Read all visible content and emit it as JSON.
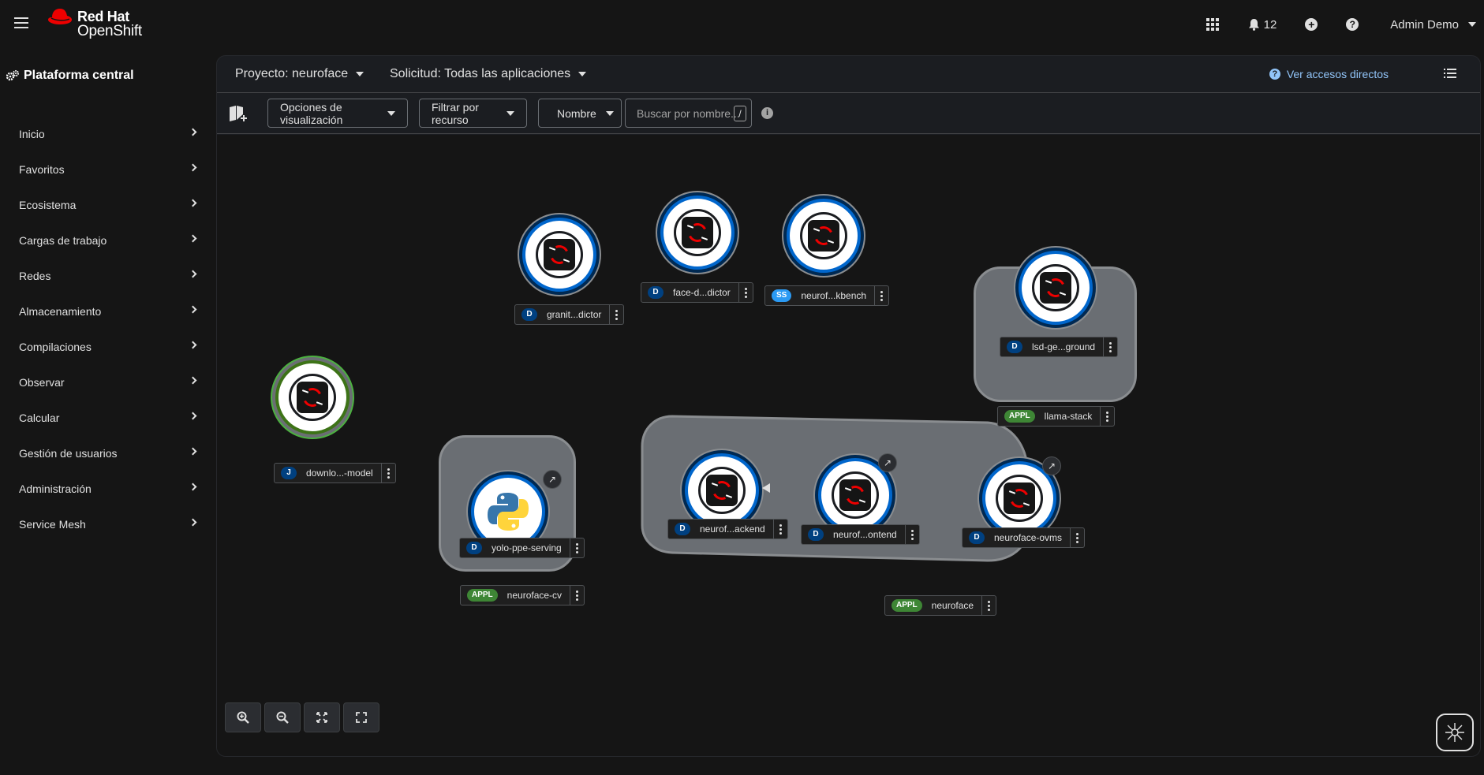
{
  "brand": {
    "line1": "Red Hat",
    "line2": "OpenShift"
  },
  "masthead": {
    "notifications_count": "12",
    "user": "Admin Demo"
  },
  "sidebar": {
    "perspective": "Plataforma central",
    "items": [
      {
        "label": "Inicio"
      },
      {
        "label": "Favoritos"
      },
      {
        "label": "Ecosistema"
      },
      {
        "label": "Cargas de trabajo"
      },
      {
        "label": "Redes"
      },
      {
        "label": "Almacenamiento"
      },
      {
        "label": "Compilaciones"
      },
      {
        "label": "Observar"
      },
      {
        "label": "Calcular"
      },
      {
        "label": "Gestión de usuarios"
      },
      {
        "label": "Administración"
      },
      {
        "label": "Service Mesh"
      }
    ]
  },
  "projectbar": {
    "project": "Proyecto: neuroface",
    "application": "Solicitud: Todas las aplicaciones",
    "shortcuts": "Ver accesos directos"
  },
  "toolbar": {
    "display_options": "Opciones de visualización",
    "filter_resource": "Filtrar por recurso",
    "filter_name": "Nombre",
    "search_placeholder": "Buscar por nombre...",
    "search_key": "/"
  },
  "topology": {
    "nodes": [
      {
        "badge": "D",
        "label": "granit...dictor"
      },
      {
        "badge": "D",
        "label": "face-d...dictor"
      },
      {
        "badge": "SS",
        "label": "neurof...kbench"
      },
      {
        "badge": "D",
        "label": "lsd-ge...ground"
      },
      {
        "badge": "J",
        "label": "downlo...-model"
      },
      {
        "badge": "D",
        "label": "yolo-ppe-serving"
      },
      {
        "badge": "D",
        "label": "neurof...ackend"
      },
      {
        "badge": "D",
        "label": "neurof...ontend"
      },
      {
        "badge": "D",
        "label": "neuroface-ovms"
      }
    ],
    "groups": [
      {
        "badge": "APPL",
        "label": "llama-stack"
      },
      {
        "badge": "APPL",
        "label": "neuroface-cv"
      },
      {
        "badge": "APPL",
        "label": "neuroface"
      }
    ]
  },
  "icons": {
    "zoom_in": "zoom-in-icon",
    "zoom_out": "zoom-out-icon",
    "fit": "fit-to-screen-icon",
    "reset": "reset-view-icon"
  }
}
